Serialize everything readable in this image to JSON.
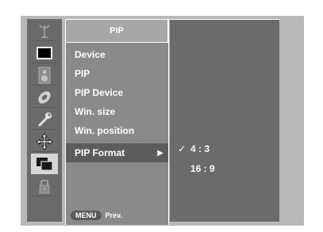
{
  "menu": {
    "title": "PIP",
    "items": [
      {
        "label": "Device"
      },
      {
        "label": "PIP"
      },
      {
        "label": "PIP Device"
      },
      {
        "label": "Win. size"
      },
      {
        "label": "Win. position"
      }
    ],
    "selected": {
      "label": "PIP Format",
      "arrow": "▶"
    },
    "footer": {
      "button": "MENU",
      "label": "Prev."
    }
  },
  "options": [
    {
      "label": "4 : 3",
      "checked": true,
      "check": "✓"
    },
    {
      "label": "16 : 9",
      "checked": false,
      "check": ""
    }
  ],
  "icons": [
    {
      "name": "antenna-icon",
      "active": false
    },
    {
      "name": "picture-icon",
      "active": false
    },
    {
      "name": "speaker-icon",
      "active": false
    },
    {
      "name": "disc-icon",
      "active": false
    },
    {
      "name": "option-wrench-icon",
      "active": false
    },
    {
      "name": "move-arrows-icon",
      "active": false
    },
    {
      "name": "pip-screen-icon",
      "active": true
    },
    {
      "name": "lock-icon",
      "active": false
    }
  ],
  "colors": {
    "osd_background": "#b8b8b8",
    "icon_column": "#6a6a6a",
    "menu_panel": "#8a8a8a",
    "selected_row": "#5c5c5c",
    "options_panel": "#6b6b6b",
    "text": "#ffffff"
  }
}
